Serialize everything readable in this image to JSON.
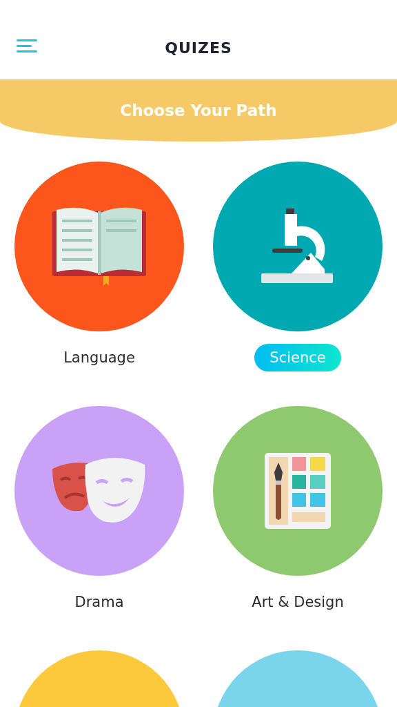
{
  "header": {
    "title": "QUIZES"
  },
  "banner": {
    "title": "Choose Your Path"
  },
  "categories": [
    {
      "label": "Language",
      "kind": "book",
      "color": "#fc561c",
      "selected": false
    },
    {
      "label": "Science",
      "kind": "microscope",
      "color": "#00a9b1",
      "selected": true
    },
    {
      "label": "Drama",
      "kind": "masks",
      "color": "#c9a2f8",
      "selected": false
    },
    {
      "label": "Art & Design",
      "kind": "palette",
      "color": "#8ec970",
      "selected": false
    },
    {
      "kind": "blank",
      "color": "#fdc93c",
      "selected": false
    },
    {
      "kind": "blank",
      "color": "#7ad5ec",
      "selected": false
    }
  ]
}
